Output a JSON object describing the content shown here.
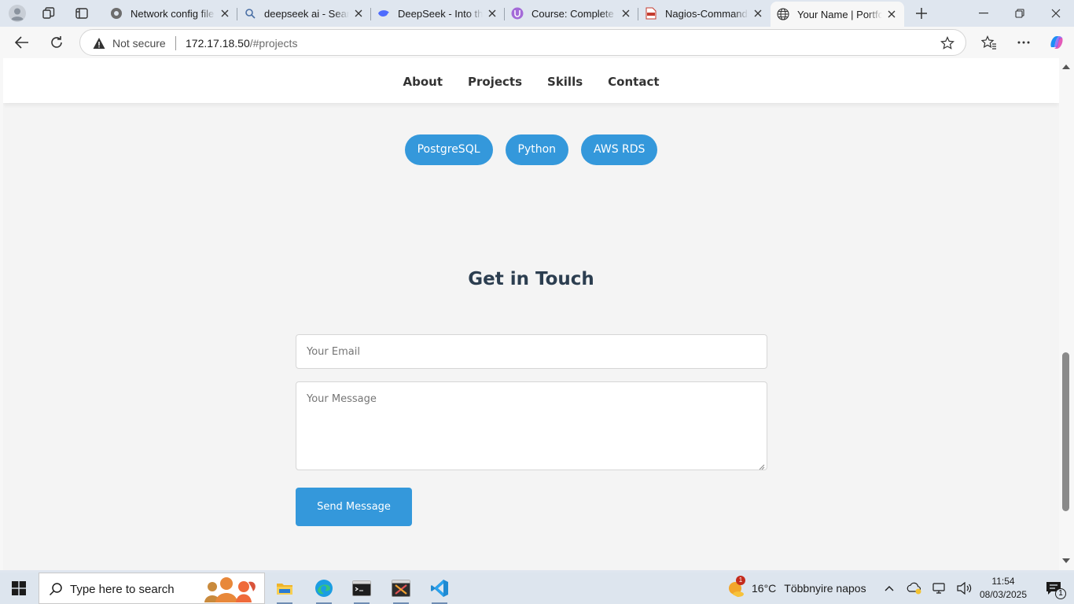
{
  "browser": {
    "tabs": [
      {
        "title": "Network config file p",
        "icon": "settings-gear-icon",
        "active": false
      },
      {
        "title": "deepseek ai - Search",
        "icon": "search-icon",
        "active": false
      },
      {
        "title": "DeepSeek - Into the",
        "icon": "deepseek-whale-icon",
        "active": false
      },
      {
        "title": "Course: Complete Li",
        "icon": "course-icon",
        "active": false
      },
      {
        "title": "Nagios-Commands.",
        "icon": "pdf-icon",
        "active": false
      },
      {
        "title": "Your Name | Portfoli",
        "icon": "globe-icon",
        "active": true
      }
    ],
    "address_bar": {
      "security_label": "Not secure",
      "url_host": "172.17.18.50",
      "url_path": "/#projects"
    }
  },
  "site": {
    "nav": [
      "About",
      "Projects",
      "Skills",
      "Contact"
    ],
    "tech_tags": [
      "PostgreSQL",
      "Python",
      "AWS RDS"
    ],
    "contact": {
      "title": "Get in Touch",
      "email_placeholder": "Your Email",
      "message_placeholder": "Your Message",
      "send_label": "Send Message"
    },
    "colors": {
      "accent": "#3498db",
      "heading": "#2c3e50",
      "background": "#f4f4f4"
    }
  },
  "taskbar": {
    "search_placeholder": "Type here to search",
    "apps": [
      "file-explorer-icon",
      "edge-icon",
      "terminal-icon",
      "screenshot-tool-icon",
      "vscode-icon"
    ],
    "weather": {
      "temp": "16°C",
      "condition": "Többnyire napos",
      "badge": "1"
    },
    "clock": {
      "time": "11:54",
      "date": "08/03/2025"
    },
    "notifications": "1"
  }
}
